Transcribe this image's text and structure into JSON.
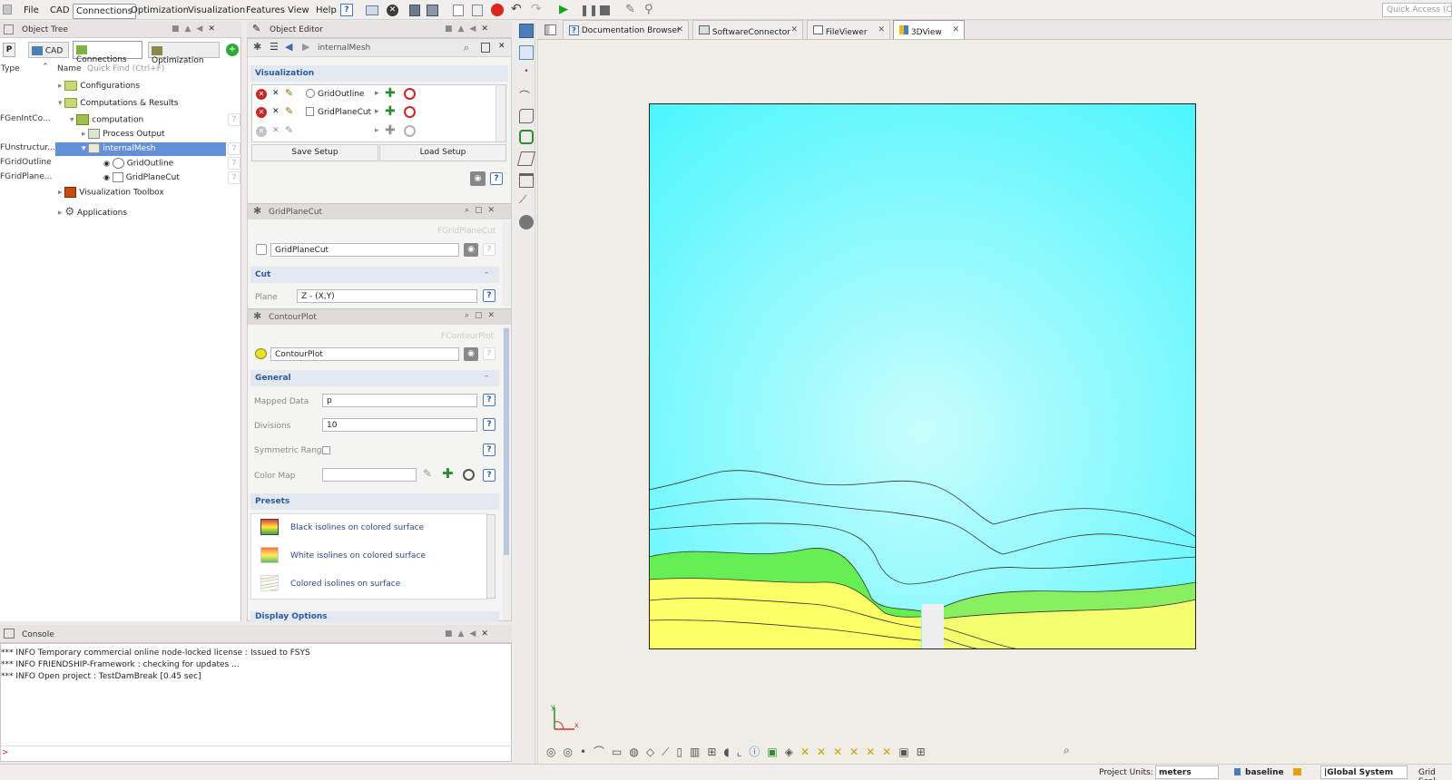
{
  "menu": [
    "File",
    "CAD",
    "Connections",
    "Optimization",
    "Visualization",
    "Features",
    "View",
    "Help"
  ],
  "active_menu": "Connections",
  "quick_access": "Quick Access (Ctr",
  "object_tree": {
    "title": "Object Tree",
    "tabs": [
      "P",
      "CAD",
      "Connections",
      "Optimization"
    ],
    "col_type": "Type",
    "col_name": "Name",
    "quick_find": "Quick Find (Ctrl+F)",
    "types": {
      "computation": "FGenIntCo...",
      "internalMesh": "FUnstructur...",
      "GridOutline": "FGridOutline",
      "GridPlaneCut": "FGridPlane..."
    },
    "items": {
      "configurations": "Configurations",
      "comp_results": "Computations & Results",
      "computation": "computation",
      "process_output": "Process Output",
      "internal_mesh": "internalMesh",
      "grid_outline": "GridOutline",
      "grid_plane_cut": "GridPlaneCut",
      "vis_toolbox": "Visualization Toolbox",
      "applications": "Applications"
    }
  },
  "object_editor": {
    "title": "Object Editor",
    "object": "internalMesh",
    "visualization": "Visualization",
    "vis_rows": [
      "GridOutline",
      "GridPlaneCut"
    ],
    "save_setup": "Save Setup",
    "load_setup": "Load Setup",
    "gridplanecut": {
      "title": "GridPlaneCut",
      "type": "FGridPlaneCut",
      "name": "GridPlaneCut",
      "section": "Cut",
      "plane_label": "Plane",
      "plane_value": "Z - (X,Y)"
    },
    "contourplot": {
      "title": "ContourPlot",
      "type": "FContourPlot",
      "name": "ContourPlot",
      "section": "General",
      "mapped_label": "Mapped Data",
      "mapped_value": "p",
      "divisions_label": "Divisions",
      "divisions_value": "10",
      "symmetric_label": "Symmetric Range",
      "colormap_label": "Color Map",
      "presets_label": "Presets",
      "presets": [
        "Black isolines on colored surface",
        "White isolines on colored surface",
        "Colored isolines on surface"
      ],
      "display_options": "Display Options"
    }
  },
  "tabs": [
    "Documentation Browser",
    "SoftwareConnector",
    "FileViewer",
    "3DView"
  ],
  "active_tab": "3DView",
  "console": {
    "title": "Console",
    "lines": [
      "*** INFO Temporary commercial online node-locked license : Issued to FSYS",
      "*** INFO FRIENDSHIP-Framework : checking for updates ...",
      "*** INFO Open project : TestDamBreak [0.45 sec]"
    ]
  },
  "status": {
    "units_label": "Project Units:",
    "units_value": "meters",
    "baseline": "baseline",
    "global_system": "|Global System",
    "grid_scale": "Grid Scal"
  },
  "axis": {
    "y": "y",
    "x": "x"
  },
  "colors": {
    "accent": "#3e6ab5",
    "selection": "#6390d6",
    "cyan": "#4ff6fd",
    "yellow": "#ffff66",
    "green": "#66ee55"
  }
}
